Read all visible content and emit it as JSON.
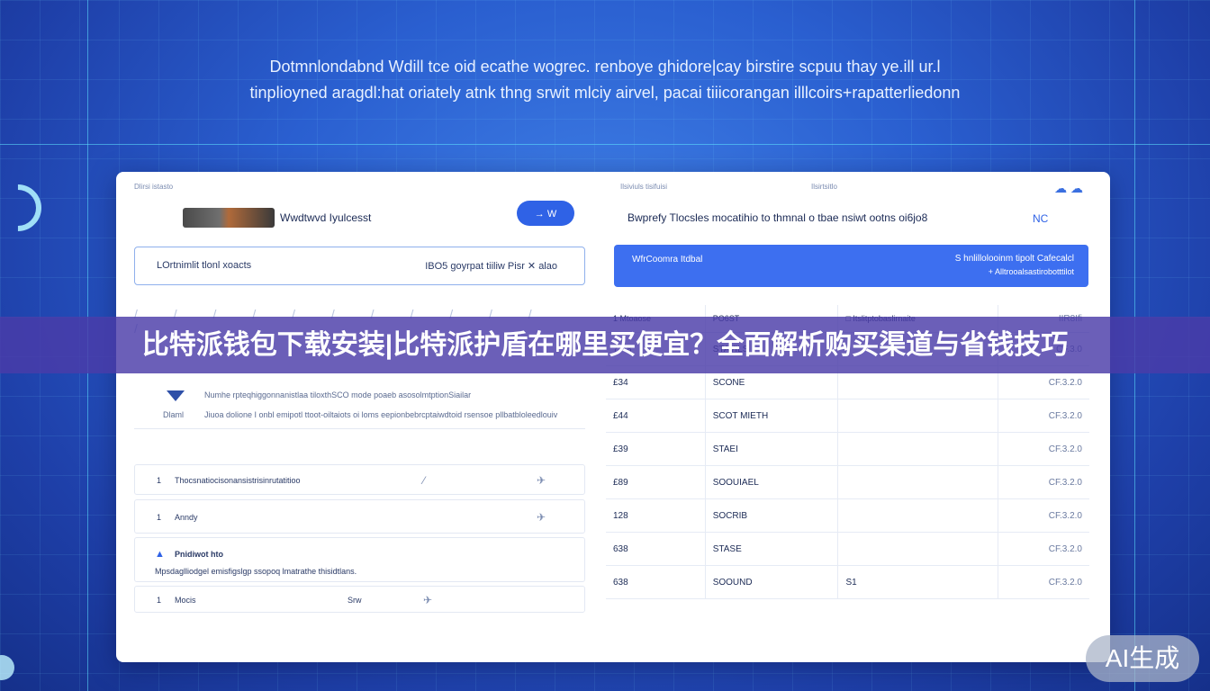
{
  "hero": {
    "line1": "Dotmnlondabnd Wdill tce oid ecathe wogrec. renboye ghidore|cay birstire scpuu thay ye.ill ur.l",
    "line2": "tinplioyned aragdl:hat oriately atnk thng srwit mlciy airvel, pacai tiiicorangan illlcoirs+rapatterliedonn"
  },
  "panel": {
    "left_caption": "Dlirsi istasto",
    "mid_caption": "Ilsiviuls tisifuisi",
    "right_caption": "Ilsirtsitlo",
    "product_title": "Wwdtwvd Iyulcesst",
    "pill_label": "→ W",
    "search_left": "LOrtnimlit tlonl xoacts",
    "search_right": "IBO5 goyrpat tiiliw Pisr ✕ alao",
    "tick_marks": "/ / / / / / / / / / / /",
    "info_line1": "Numhe rpteqhiggonnanistlaa tiloxthSCO mode poaeb asosolmtptionSiailar",
    "info_line2": "Jiuoa dolione I onbl emipotl ttoot-oiltaiots oi loms eepionbebrcptaiwdtoid rsensoe pllbatbloleedlouiv",
    "info_label": "Dlaml",
    "list": [
      {
        "num": "1",
        "text": "Thocsnatiocisonansistrisinrutatitioo"
      },
      {
        "num": "1",
        "text": "Anndy"
      },
      {
        "num": "",
        "text": "Pnidiwot hto",
        "sub": "Mpsdaglliodgel emisfigslgp ssopoq lmatrathe thisidtlans."
      },
      {
        "num": "1",
        "text": "Mocis"
      }
    ],
    "list_extra": "Srw",
    "right_title": "Bwprefy  Tlocsles mocatihio to thmnal o tbae nsiwt ootns oi6jo8",
    "right_code": "NC",
    "banner_left": "WfrCoomra Itdbal",
    "banner_right1": "S hnlillolooinm tipolt Cafecalcl",
    "banner_right2": "+ Alltrooalsastirobotttilot",
    "table_headers": [
      "1  Mtoaose",
      "PO6ST",
      "□  Itslitptobaslirnaite",
      "IIR8Ifi"
    ],
    "table_rows": [
      {
        "a": "7.A8",
        "b": "STAVILS",
        "c": "",
        "d": "CF.3.0"
      },
      {
        "a": "£34",
        "b": "SCONE",
        "c": "",
        "d": "CF.3.2.0"
      },
      {
        "a": "£44",
        "b": "SCOT MIETH",
        "c": "",
        "d": "CF.3.2.0"
      },
      {
        "a": "£39",
        "b": "STAEI",
        "c": "",
        "d": "CF.3.2.0"
      },
      {
        "a": "£89",
        "b": "SOOUIAEL",
        "c": "",
        "d": "CF.3.2.0"
      },
      {
        "a": "128",
        "b": "SOCRIB",
        "c": "",
        "d": "CF.3.2.0"
      },
      {
        "a": "638",
        "b": "STASE",
        "c": "",
        "d": "CF.3.2.0"
      },
      {
        "a": "638",
        "b": "SOOUND",
        "c": "S1",
        "d": "CF.3.2.0"
      }
    ]
  },
  "caption": "比特派钱包下载安装|比特派护盾在哪里买便宜？全面解析购买渠道与省钱技巧",
  "badge": "AI生成",
  "colors": {
    "accent": "#2f62e6",
    "banner": "#3d6ff0",
    "caption_band": "#4a3ca8"
  }
}
